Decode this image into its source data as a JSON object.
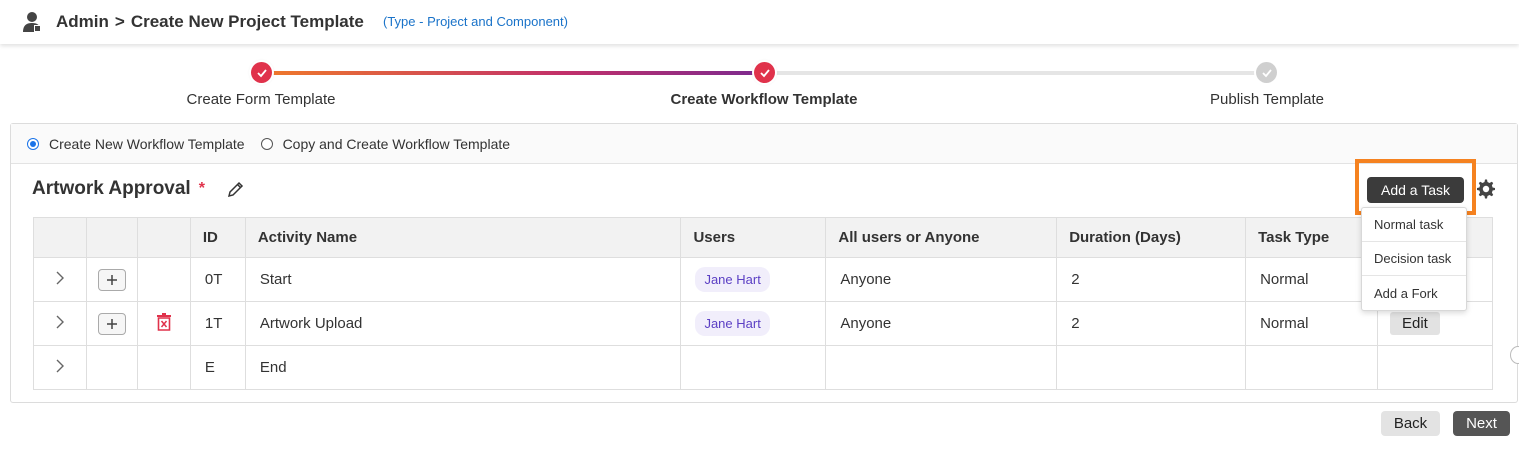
{
  "header": {
    "crumb_root": "Admin",
    "crumb_sep": ">",
    "crumb_page": "Create New Project Template",
    "type_note": "(Type - Project and Component)"
  },
  "stepper": {
    "steps": [
      {
        "label": "Create Form Template",
        "status": "done"
      },
      {
        "label": "Create Workflow Template",
        "status": "done"
      },
      {
        "label": "Publish Template",
        "status": "todo"
      }
    ]
  },
  "mode": {
    "options": [
      {
        "label": "Create New Workflow Template",
        "selected": true
      },
      {
        "label": "Copy and Create Workflow Template",
        "selected": false
      }
    ]
  },
  "workflow": {
    "title": "Artwork Approval",
    "required_mark": "*",
    "add_task_label": "Add a Task"
  },
  "table": {
    "headers": [
      "",
      "",
      "",
      "ID",
      "Activity Name",
      "Users",
      "All users or Anyone",
      "Duration (Days)",
      "Task Type",
      ""
    ],
    "rows": [
      {
        "id": "0T",
        "activity": "Start",
        "user": "Jane Hart",
        "assignment": "Anyone",
        "duration": "2",
        "task_type": "Normal"
      },
      {
        "id": "1T",
        "activity": "Artwork Upload",
        "user": "Jane Hart",
        "assignment": "Anyone",
        "duration": "2",
        "task_type": "Normal",
        "edit_label": "Edit"
      },
      {
        "id": "E",
        "activity": "End",
        "user": "",
        "assignment": "",
        "duration": "",
        "task_type": ""
      }
    ]
  },
  "dropdown": {
    "items": [
      "Normal task",
      "Decision task",
      "Add a Fork"
    ]
  },
  "footer": {
    "back_label": "Back",
    "next_label": "Next"
  },
  "colors": {
    "accent_red": "#e0324b",
    "highlight_orange": "#f58220",
    "link_blue": "#1a73c9"
  }
}
